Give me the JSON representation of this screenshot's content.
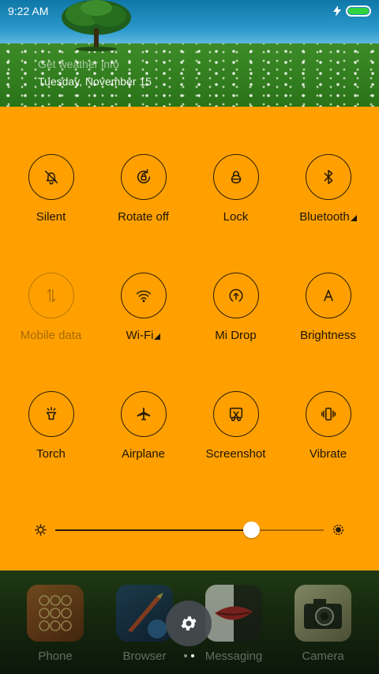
{
  "status_bar": {
    "time": "9:22 AM",
    "charging_icon": "bolt-icon",
    "battery_icon": "battery-icon",
    "battery_level": 1.0,
    "battery_color": "#31d33f"
  },
  "header": {
    "weather_link": "Get weather info",
    "date": "Tuesday, November 15"
  },
  "panel": {
    "background": "#ffa000",
    "toggles": [
      {
        "label": "Silent",
        "icon": "bell-off-icon",
        "active": true,
        "expandable": false
      },
      {
        "label": "Rotate off",
        "icon": "rotate-lock-icon",
        "active": true,
        "expandable": false
      },
      {
        "label": "Lock",
        "icon": "lock-icon",
        "active": true,
        "expandable": false
      },
      {
        "label": "Bluetooth",
        "icon": "bluetooth-icon",
        "active": true,
        "expandable": true
      },
      {
        "label": "Mobile data",
        "icon": "mobile-data-icon",
        "active": false,
        "expandable": false
      },
      {
        "label": "Wi-Fi",
        "icon": "wifi-icon",
        "active": true,
        "expandable": true
      },
      {
        "label": "Mi Drop",
        "icon": "mi-drop-icon",
        "active": true,
        "expandable": false
      },
      {
        "label": "Brightness",
        "icon": "brightness-auto-icon",
        "active": true,
        "expandable": false
      },
      {
        "label": "Torch",
        "icon": "torch-icon",
        "active": true,
        "expandable": false
      },
      {
        "label": "Airplane",
        "icon": "airplane-icon",
        "active": true,
        "expandable": false
      },
      {
        "label": "Screenshot",
        "icon": "screenshot-icon",
        "active": true,
        "expandable": false
      },
      {
        "label": "Vibrate",
        "icon": "vibrate-icon",
        "active": true,
        "expandable": false
      }
    ],
    "brightness": {
      "level": 0.73,
      "min_icon": "brightness-low-icon",
      "max_icon": "brightness-high-icon"
    }
  },
  "dock": {
    "apps": [
      {
        "label": "Phone",
        "icon": "phone-app-icon"
      },
      {
        "label": "Browser",
        "icon": "browser-app-icon"
      },
      {
        "label": "Messaging",
        "icon": "messaging-app-icon"
      },
      {
        "label": "Camera",
        "icon": "camera-app-icon"
      }
    ],
    "settings_icon": "gear-icon",
    "pages": 2,
    "current_page": 2
  }
}
